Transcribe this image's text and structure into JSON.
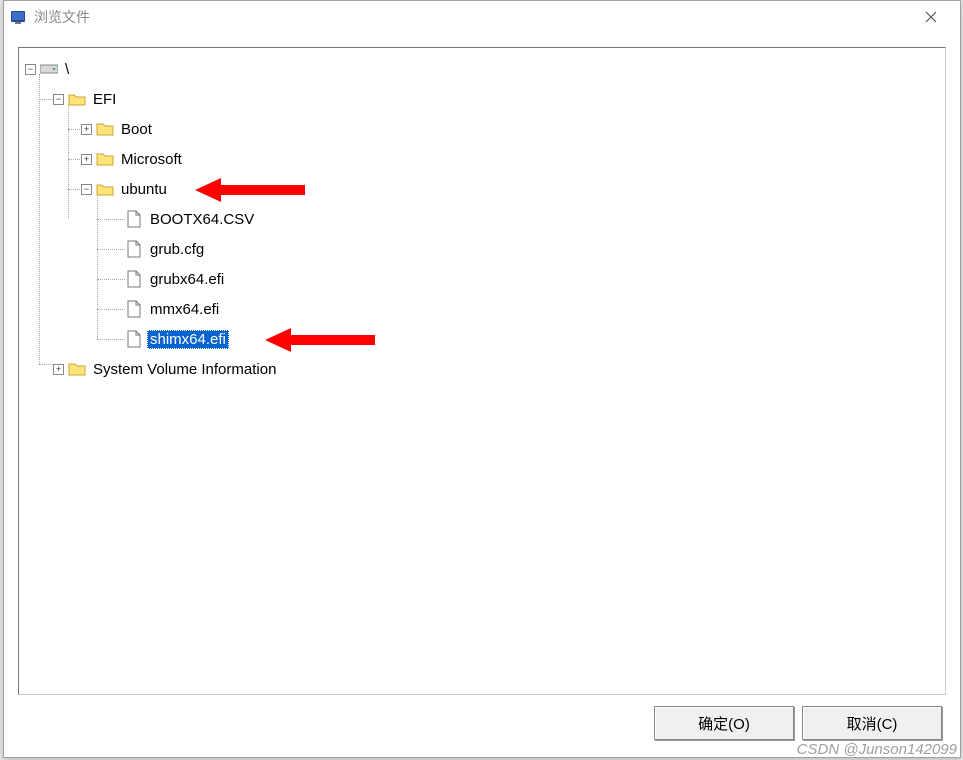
{
  "window": {
    "title": "浏览文件"
  },
  "tree": {
    "root": "\\",
    "efi": "EFI",
    "boot": "Boot",
    "microsoft": "Microsoft",
    "ubuntu": "ubuntu",
    "files": {
      "bootx64csv": "BOOTX64.CSV",
      "grubcfg": "grub.cfg",
      "grubx64efi": "grubx64.efi",
      "mmx64efi": "mmx64.efi",
      "shimx64efi": "shimx64.efi"
    },
    "sysvol": "System Volume Information"
  },
  "buttons": {
    "ok": "确定(O)",
    "cancel": "取消(C)"
  },
  "watermark": "CSDN @Junson142099"
}
